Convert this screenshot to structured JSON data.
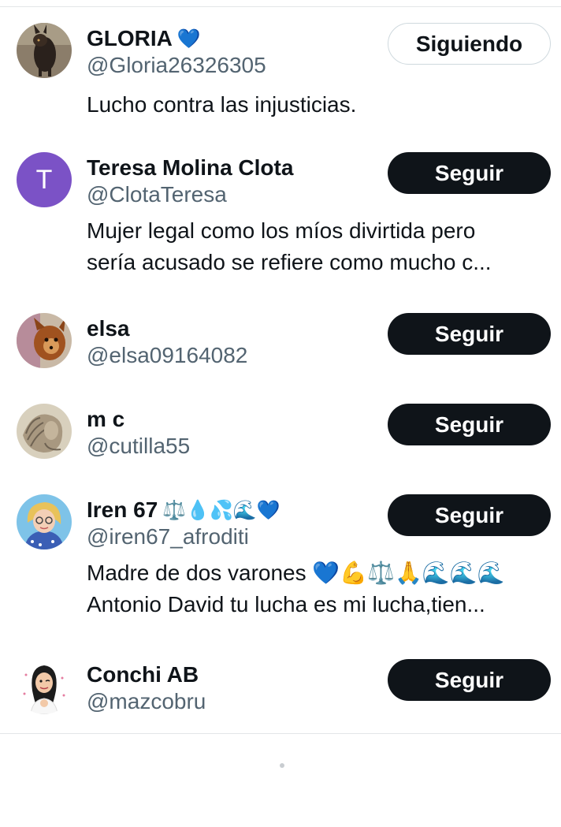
{
  "users": [
    {
      "name": "GLORIA",
      "name_emoji": "💙",
      "handle": "@Gloria26326305",
      "bio_lines": [
        "Lucho contra las injusticias."
      ],
      "button": "Siguiendo",
      "avatar": "dog-photo"
    },
    {
      "name": "Teresa Molina Clota",
      "handle": "@ClotaTeresa",
      "bio_lines": [
        "Mujer legal como los míos divirtida pero",
        "sería acusado se refiere como mucho c..."
      ],
      "button": "Seguir",
      "avatar_letter": "T",
      "avatar_color": "#7b52c6"
    },
    {
      "name": "elsa",
      "handle": "@elsa09164082",
      "button": "Seguir",
      "avatar": "small-dog-photo"
    },
    {
      "name": "m c",
      "handle": "@cutilla55",
      "button": "Seguir",
      "avatar": "sculpture-photo"
    },
    {
      "name": "Iren 67",
      "name_emoji": "⚖️💧💦🌊💙",
      "handle": "@iren67_afroditi",
      "bio_lines": [
        "Madre de dos varones 💙💪⚖️🙏🌊🌊🌊",
        "Antonio David tu lucha es mi lucha,tien..."
      ],
      "button": "Seguir",
      "avatar": "cartoon-woman"
    },
    {
      "name": "Conchi AB",
      "handle": "@mazcobru",
      "button": "Seguir",
      "avatar": "cartoon-girl"
    }
  ],
  "colors": {
    "text": "#0f1419",
    "secondary": "#536471",
    "follow_bg": "#0f1419",
    "following_border": "#cfd9de"
  }
}
